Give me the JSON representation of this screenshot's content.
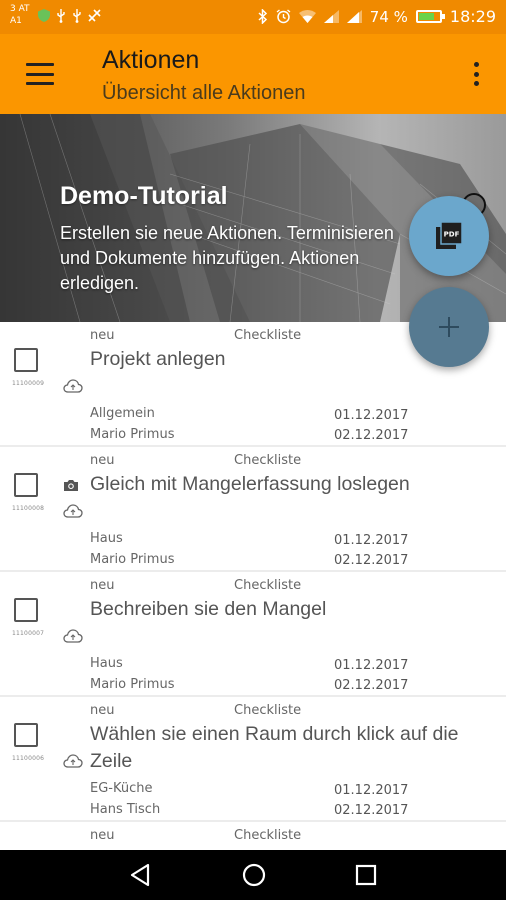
{
  "status_bar": {
    "carrier_line1": "3 AT",
    "carrier_line2": "A1",
    "battery_percent": "74 %",
    "battery_level": 0.74,
    "time": "18:29",
    "icons": [
      "shield-icon",
      "usb-icon",
      "usb-icon",
      "dashboard-icon",
      "bluetooth-icon",
      "alarm-icon",
      "wifi-icon",
      "signal-icon",
      "signal-icon",
      "battery-icon"
    ]
  },
  "app_bar": {
    "title": "Aktionen",
    "subtitle": "Übersicht alle Aktionen",
    "menu_icon": "hamburger-menu-icon",
    "overflow_icon": "more-vertical-icon",
    "background_color": "#fb9600"
  },
  "banner": {
    "title": "Demo-Tutorial",
    "text": "Erstellen sie neue Aktionen. Terminisieren und Dokumente hinzufügen. Aktionen erledigen."
  },
  "fabs": {
    "pdf_icon": "pdf-icon",
    "pdf_color": "#6ba7cc",
    "add_icon": "plus-icon",
    "add_color": "#567a91"
  },
  "items": [
    {
      "id": "11100009",
      "status": "neu",
      "type": "Checkliste",
      "title": "Projekt anlegen",
      "category": "Allgemein",
      "person": "Mario Primus",
      "date_start": "01.12.2017",
      "date_end": "02.12.2017",
      "has_camera": false
    },
    {
      "id": "11100008",
      "status": "neu",
      "type": "Checkliste",
      "title": "Gleich mit Mangelerfassung loslegen",
      "category": "Haus",
      "person": "Mario Primus",
      "date_start": "01.12.2017",
      "date_end": "02.12.2017",
      "has_camera": true
    },
    {
      "id": "11100007",
      "status": "neu",
      "type": "Checkliste",
      "title": "Bechreiben sie den Mangel",
      "category": "Haus",
      "person": "Mario Primus",
      "date_start": "01.12.2017",
      "date_end": "02.12.2017",
      "has_camera": false
    },
    {
      "id": "11100006",
      "status": "neu",
      "type": "Checkliste",
      "title": "Wählen sie einen Raum durch klick auf die Zeile",
      "category": "EG-Küche",
      "person": "Hans Tisch",
      "date_start": "01.12.2017",
      "date_end": "02.12.2017",
      "has_camera": false
    },
    {
      "status": "neu",
      "type": "Checkliste"
    }
  ],
  "nav_bar": {
    "back_icon": "back-triangle-icon",
    "home_icon": "home-circle-icon",
    "recent_icon": "recent-apps-square-icon"
  }
}
